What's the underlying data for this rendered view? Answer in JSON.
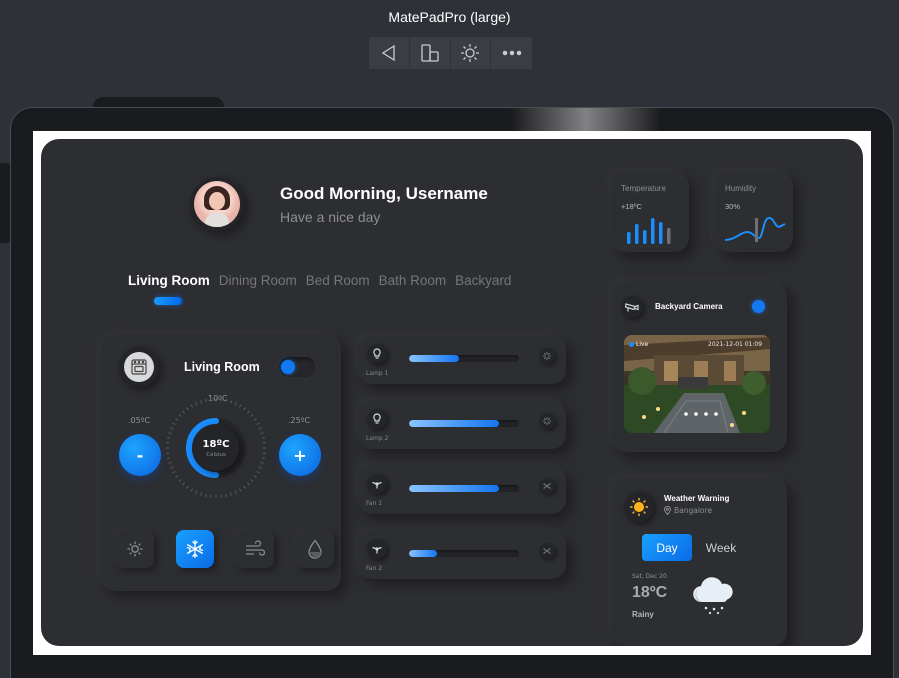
{
  "emulator": {
    "title": "MatePadPro (large)",
    "toolbar": [
      "back-icon",
      "rotate-icon",
      "brightness-icon",
      "more-icon"
    ]
  },
  "profile": {
    "greeting": "Good Morning, Username",
    "subtitle": "Have a nice day"
  },
  "tabs": [
    {
      "label": "Living Room",
      "active": true
    },
    {
      "label": "Dining Room",
      "active": false
    },
    {
      "label": "Bed Room",
      "active": false
    },
    {
      "label": "Bath Room",
      "active": false
    },
    {
      "label": "Backyard",
      "active": false
    }
  ],
  "room": {
    "title": "Living Room",
    "min_temp": ".05ºC",
    "max_temp": ".25ºC",
    "dial_top": "10ºC",
    "current_temp": "18ºC",
    "unit": "Celsius",
    "minus": "-",
    "plus": "+",
    "modes": [
      "sun-icon",
      "snowflake-icon",
      "wind-icon",
      "droplet-icon"
    ],
    "active_mode": 1
  },
  "devices": [
    {
      "label": "Lamp 1",
      "icon": "lamp-icon",
      "level": 0.45
    },
    {
      "label": "Lamp 2",
      "icon": "lamp-icon",
      "level": 0.82
    },
    {
      "label": "Fan 1",
      "icon": "fan-icon",
      "level": 0.82
    },
    {
      "label": "Fan 2",
      "icon": "fan-icon",
      "level": 0.25
    }
  ],
  "sensors": {
    "temperature": {
      "label": "Temperature",
      "value": "+18ºC"
    },
    "humidity": {
      "label": "Humidity",
      "value": "30%"
    }
  },
  "camera": {
    "title": "Backyard Camera",
    "live": "Live",
    "timestamp": "2021-12-01 01:09"
  },
  "weather": {
    "title": "Weather Warning",
    "location": "Bangalore",
    "tabs": [
      "Day",
      "Week"
    ],
    "date": "Sat, Dec 20",
    "temp": "18ºC",
    "condition": "Rainy"
  },
  "colors": {
    "accent": "#1279f0",
    "background": "#2d2e31"
  }
}
